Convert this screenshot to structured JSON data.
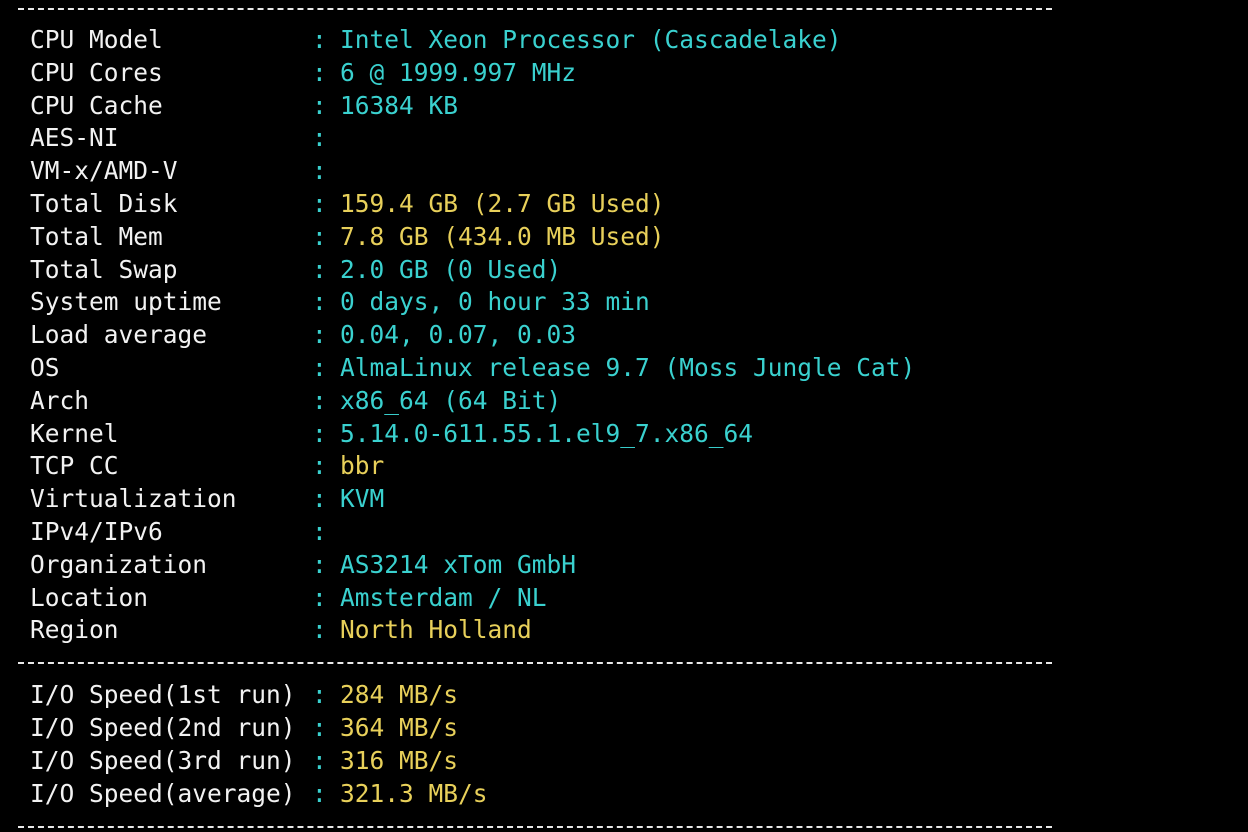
{
  "separator": "------------------------------------------------------------------------------------------------",
  "colon": ":",
  "colors": {
    "background": "#000000",
    "label": "#f2f2f2",
    "cyan": "#3ad1cf",
    "yellow": "#e8d05a"
  },
  "system_info": [
    {
      "label": "CPU Model",
      "value": "Intel Xeon Processor (Cascadelake)",
      "color": "cyan"
    },
    {
      "label": "CPU Cores",
      "value": "6 @ 1999.997 MHz",
      "color": "cyan"
    },
    {
      "label": "CPU Cache",
      "value": "16384 KB",
      "color": "cyan"
    },
    {
      "label": "AES-NI",
      "value": "",
      "color": "cyan"
    },
    {
      "label": "VM-x/AMD-V",
      "value": "",
      "color": "cyan"
    },
    {
      "label": "Total Disk",
      "value": "159.4 GB (2.7 GB Used)",
      "color": "yellow"
    },
    {
      "label": "Total Mem",
      "value": "7.8 GB (434.0 MB Used)",
      "color": "yellow"
    },
    {
      "label": "Total Swap",
      "value": "2.0 GB (0 Used)",
      "color": "cyan"
    },
    {
      "label": "System uptime",
      "value": "0 days, 0 hour 33 min",
      "color": "cyan"
    },
    {
      "label": "Load average",
      "value": "0.04, 0.07, 0.03",
      "color": "cyan"
    },
    {
      "label": "OS",
      "value": "AlmaLinux release 9.7 (Moss Jungle Cat)",
      "color": "cyan"
    },
    {
      "label": "Arch",
      "value": "x86_64 (64 Bit)",
      "color": "cyan"
    },
    {
      "label": "Kernel",
      "value": "5.14.0-611.55.1.el9_7.x86_64",
      "color": "cyan"
    },
    {
      "label": "TCP CC",
      "value": "bbr",
      "color": "yellow"
    },
    {
      "label": "Virtualization",
      "value": "KVM",
      "color": "cyan"
    },
    {
      "label": "IPv4/IPv6",
      "value": "",
      "color": "cyan"
    },
    {
      "label": "Organization",
      "value": "AS3214 xTom GmbH",
      "color": "cyan"
    },
    {
      "label": "Location",
      "value": "Amsterdam / NL",
      "color": "cyan"
    },
    {
      "label": "Region",
      "value": "North Holland",
      "color": "yellow"
    }
  ],
  "io_speed": [
    {
      "label": "I/O Speed(1st run)",
      "value": "284 MB/s",
      "color": "yellow"
    },
    {
      "label": "I/O Speed(2nd run)",
      "value": "364 MB/s",
      "color": "yellow"
    },
    {
      "label": "I/O Speed(3rd run)",
      "value": "316 MB/s",
      "color": "yellow"
    },
    {
      "label": "I/O Speed(average)",
      "value": "321.3 MB/s",
      "color": "yellow"
    }
  ]
}
